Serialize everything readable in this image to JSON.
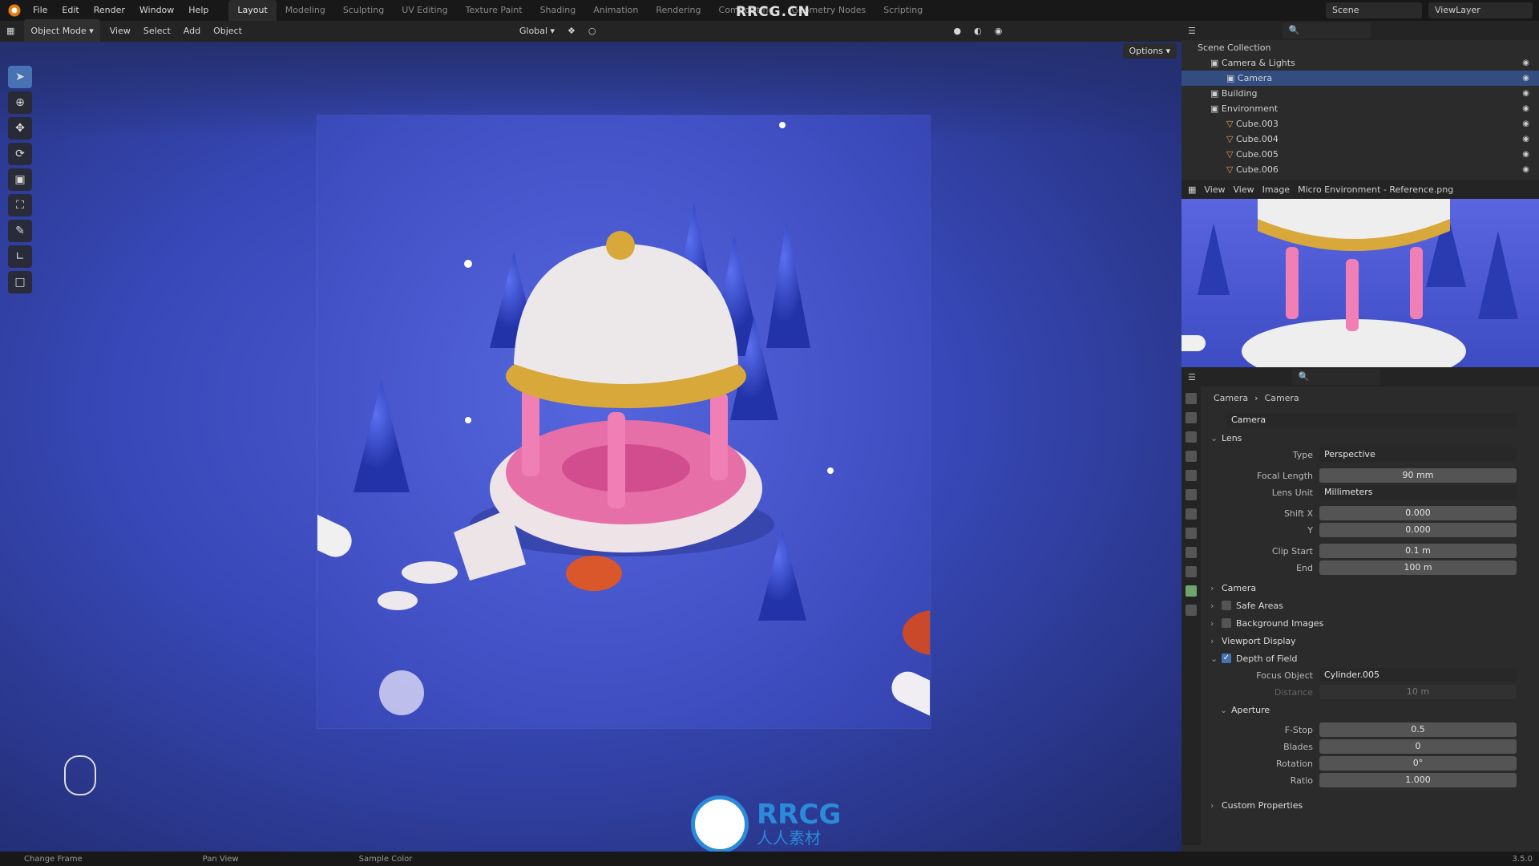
{
  "topbar": {
    "menus": [
      "File",
      "Edit",
      "Render",
      "Window",
      "Help"
    ],
    "workspaces": [
      "Layout",
      "Modeling",
      "Sculpting",
      "UV Editing",
      "Texture Paint",
      "Shading",
      "Animation",
      "Rendering",
      "Compositing",
      "Geometry Nodes",
      "Scripting"
    ],
    "active_workspace": "Layout",
    "scene": "Scene",
    "view_layer": "ViewLayer",
    "watermark": "RRCG.CN"
  },
  "viewport_header": {
    "mode": "Object Mode",
    "menus": [
      "View",
      "Select",
      "Add",
      "Object"
    ],
    "transform": "Global",
    "options": "Options"
  },
  "statusbar": {
    "items": [
      "Change Frame",
      "Pan View",
      "Sample Color"
    ],
    "version": "3.5.0"
  },
  "outliner": {
    "root": "Scene Collection",
    "rows": [
      {
        "label": "Camera & Lights",
        "selected": false
      },
      {
        "label": "Camera",
        "selected": true
      },
      {
        "label": "Building",
        "selected": false
      },
      {
        "label": "Environment",
        "selected": false
      },
      {
        "label": "Cube.003",
        "selected": false
      },
      {
        "label": "Cube.004",
        "selected": false
      },
      {
        "label": "Cube.005",
        "selected": false
      },
      {
        "label": "Cube.006",
        "selected": false
      }
    ]
  },
  "image_editor": {
    "menus": [
      "View",
      "View",
      "Image"
    ],
    "image_name": "Micro Environment - Reference.png"
  },
  "properties": {
    "breadcrumb": [
      "Camera",
      "Camera"
    ],
    "datablock": "Camera",
    "lens_section": "Lens",
    "type_label": "Type",
    "type_value": "Perspective",
    "focal_label": "Focal Length",
    "focal_value": "90 mm",
    "lensunit_label": "Lens Unit",
    "lensunit_value": "Millimeters",
    "shiftx_label": "Shift X",
    "shiftx_value": "0.000",
    "shifty_label": "Y",
    "shifty_value": "0.000",
    "clipstart_label": "Clip Start",
    "clipstart_value": "0.1 m",
    "clipend_label": "End",
    "clipend_value": "100 m",
    "camera_section": "Camera",
    "safe_section": "Safe Areas",
    "bg_section": "Background Images",
    "vpdisplay_section": "Viewport Display",
    "dof_section": "Depth of Field",
    "focus_label": "Focus Object",
    "focus_value": "Cylinder.005",
    "distance_label": "Distance",
    "distance_value": "10 m",
    "aperture_section": "Aperture",
    "fstop_label": "F-Stop",
    "fstop_value": "0.5",
    "blades_label": "Blades",
    "blades_value": "0",
    "rotation_label": "Rotation",
    "rotation_value": "0°",
    "ratio_label": "Ratio",
    "ratio_value": "1.000",
    "custom_section": "Custom Properties"
  },
  "logo": {
    "brand": "RRCG",
    "subtitle": "人人素材"
  }
}
